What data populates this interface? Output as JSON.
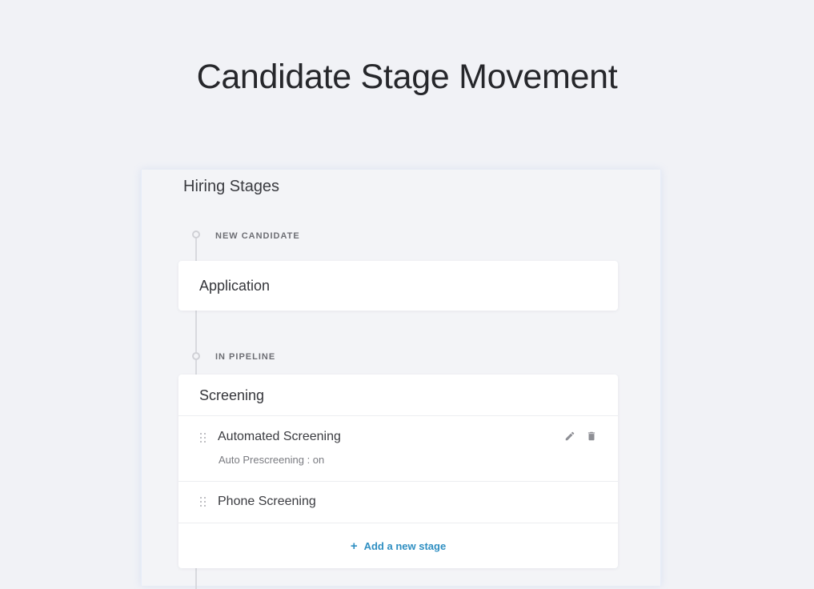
{
  "page": {
    "title": "Candidate Stage Movement"
  },
  "panel": {
    "title": "Hiring Stages",
    "sections": [
      {
        "label": "NEW CANDIDATE"
      },
      {
        "label": "IN PIPELINE"
      }
    ],
    "application_card": {
      "title": "Application"
    },
    "screening_card": {
      "title": "Screening",
      "stages": [
        {
          "name": "Automated Screening",
          "detail": "Auto Prescreening : on"
        },
        {
          "name": "Phone Screening"
        }
      ],
      "add_stage_label": "Add a new stage",
      "add_icon": "+"
    }
  },
  "colors": {
    "background": "#f1f2f6",
    "card": "#ffffff",
    "accent": "#2f8fc2",
    "icon": "#8e8f95",
    "timeline": "#d8d9de"
  },
  "icons": [
    "edit-icon",
    "trash-icon",
    "drag-handle-icon",
    "plus-icon"
  ]
}
